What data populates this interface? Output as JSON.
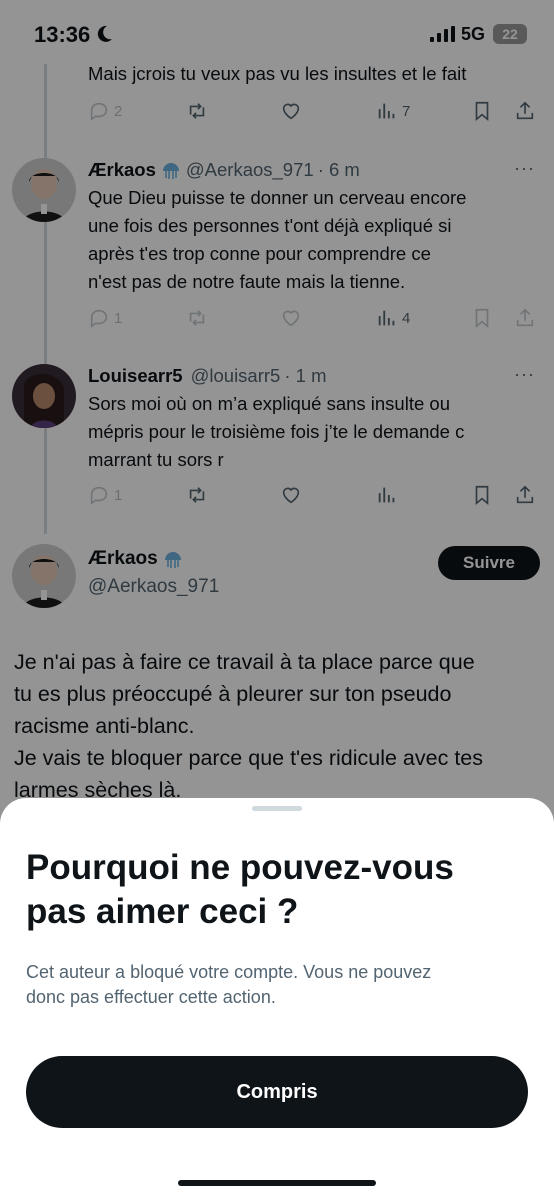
{
  "status": {
    "time": "13:36",
    "network": "5G",
    "battery": "22"
  },
  "thread": {
    "reply0": {
      "text": "Mais jcrois tu veux pas vu les insultes et le fait",
      "replies": "2",
      "views": "7"
    },
    "reply1": {
      "name": "Ærkaos",
      "handle": "@Aerkaos_971",
      "time": "· 6 m",
      "lines": [
        "Que Dieu puisse te donner un cerveau encore",
        "une fois des personnes t'ont déjà expliqué si",
        "après t'es trop conne pour comprendre ce",
        "n'est pas de notre faute mais la tienne."
      ],
      "replies": "1",
      "views": "4"
    },
    "reply2": {
      "name": "Louisearr5",
      "handle": "@louisarr5",
      "time": "· 1 m",
      "lines": [
        "Sors moi où on m’a expliqué sans insulte ou",
        "mépris pour le troisième fois j’te le demande c",
        "marrant tu sors r"
      ],
      "replies": "1"
    },
    "main": {
      "name": "Ærkaos",
      "handle": "@Aerkaos_971",
      "follow_label": "Suivre",
      "lines": [
        "Je n'ai pas à faire ce travail à ta place parce que",
        "tu es plus préoccupé à pleurer sur ton pseudo",
        "racisme anti-blanc.",
        "Je vais te bloquer parce que t'es ridicule avec tes",
        "larmes sèches là."
      ]
    },
    "more_label": "···"
  },
  "sheet": {
    "title_line1": "Pourquoi ne pouvez-vous",
    "title_line2": "pas aimer ceci ?",
    "desc_line1": "Cet auteur a bloqué votre compte. Vous ne pouvez",
    "desc_line2": "donc pas effectuer cette action.",
    "button_label": "Compris"
  },
  "colors": {
    "text": "#0f1419",
    "secondary": "#536471",
    "dark_button": "#0f1419",
    "thread_line": "#cfd9de"
  }
}
